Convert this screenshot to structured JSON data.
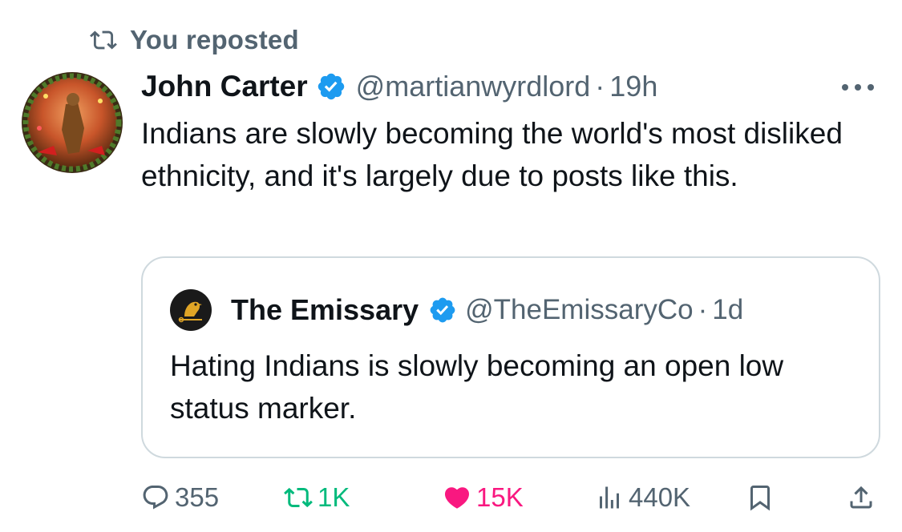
{
  "repost_banner": {
    "label": "You reposted"
  },
  "tweet": {
    "author_name": "John Carter",
    "handle": "@martianwyrdlord",
    "separator": "·",
    "time": "19h",
    "text": "Indians are slowly becoming the world's most disliked ethnicity, and it's largely due to posts like this."
  },
  "quoted_tweet": {
    "author_name": "The Emissary",
    "handle": "@TheEmissaryCo",
    "separator": "·",
    "time": "1d",
    "text": "Hating Indians is slowly becoming an open low status marker."
  },
  "actions": {
    "replies": "355",
    "reposts": "1K",
    "likes": "15K",
    "views": "440K"
  },
  "colors": {
    "verified_blue": "#1d9bf0",
    "repost_green": "#00ba7c",
    "like_pink": "#f91880",
    "secondary_text": "#536471",
    "border": "#cfd9de"
  },
  "icons": [
    "repost-icon",
    "verified-badge-icon",
    "more-icon",
    "reply-icon",
    "heart-icon",
    "views-icon",
    "bookmark-icon",
    "share-icon"
  ]
}
